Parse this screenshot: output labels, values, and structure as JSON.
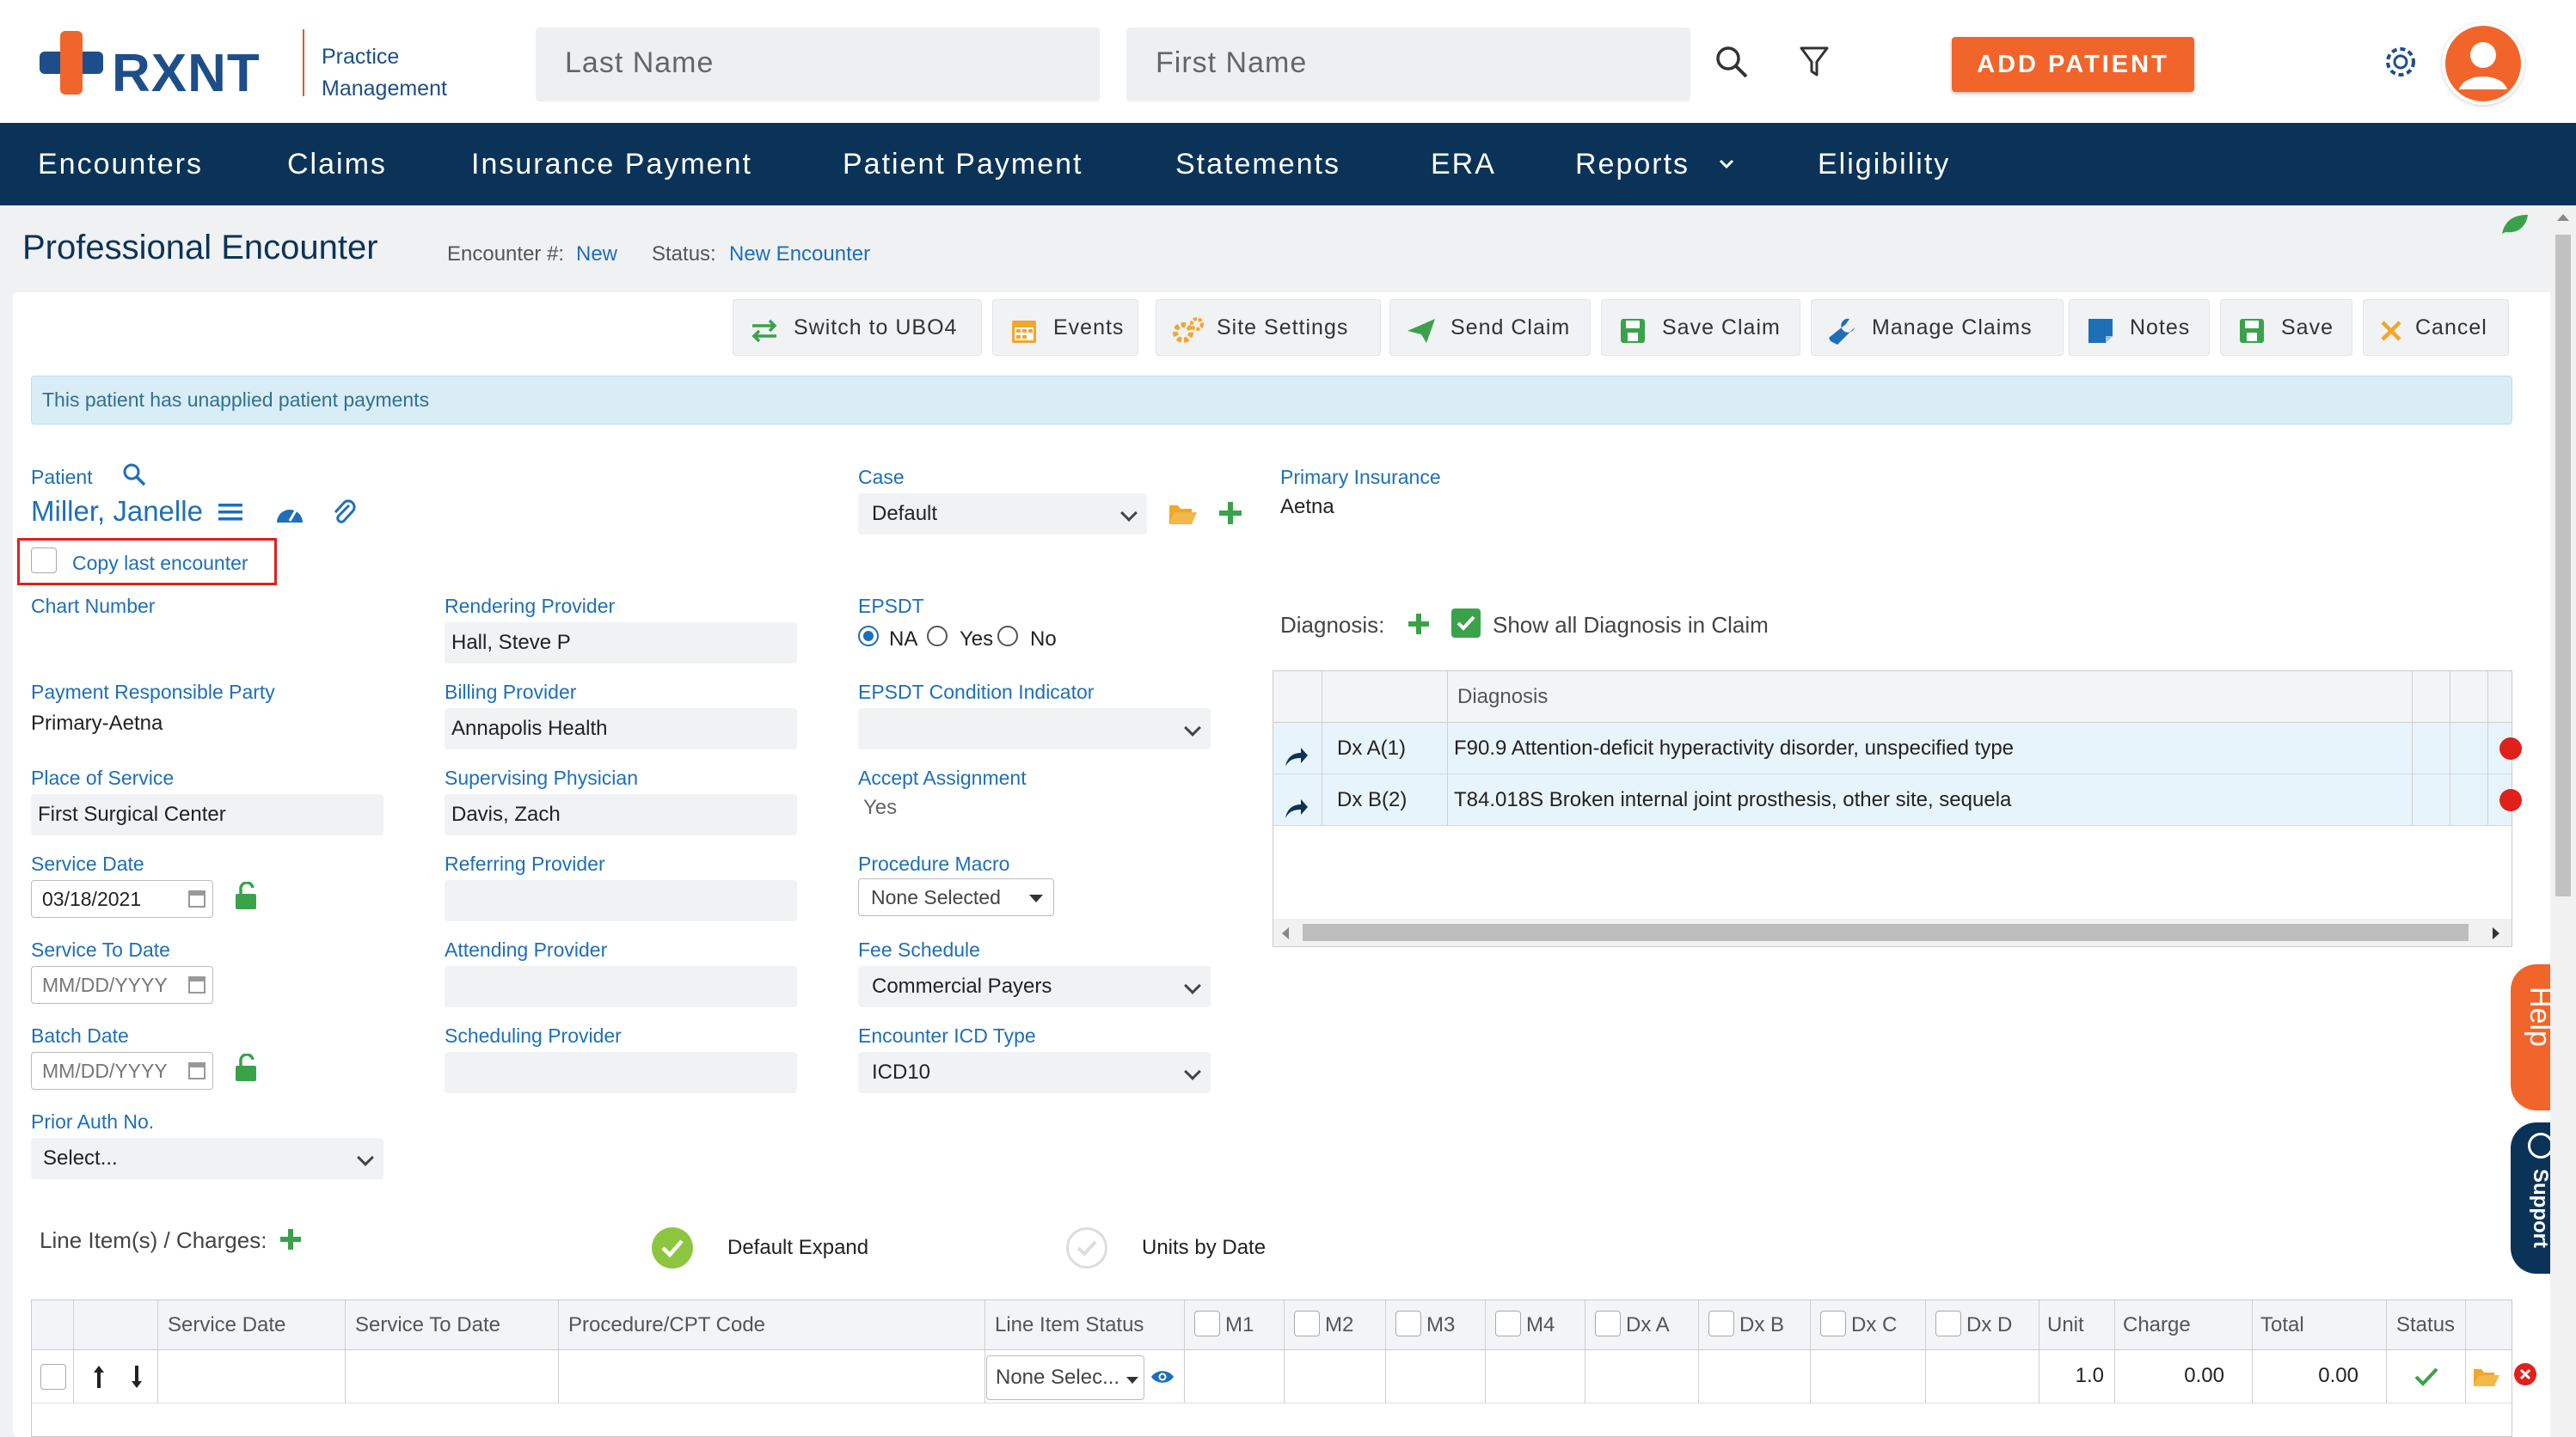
{
  "header": {
    "brand": "RXNT",
    "brand_sub_1": "Practice",
    "brand_sub_2": "Management",
    "last_name_placeholder": "Last Name",
    "first_name_placeholder": "First Name",
    "add_patient_label": "ADD PATIENT"
  },
  "nav": {
    "items": [
      "Encounters",
      "Claims",
      "Insurance Payment",
      "Patient Payment",
      "Statements",
      "ERA",
      "Reports",
      "Eligibility"
    ]
  },
  "page": {
    "title": "Professional Encounter",
    "encounter_label": "Encounter #:",
    "encounter_value": "New",
    "status_label": "Status:",
    "status_value": "New Encounter"
  },
  "toolbar": {
    "switch": "Switch to UBO4",
    "events": "Events",
    "site_settings": "Site Settings",
    "send_claim": "Send Claim",
    "save_claim": "Save Claim",
    "manage_claims": "Manage Claims",
    "notes": "Notes",
    "save": "Save",
    "cancel": "Cancel"
  },
  "alert": "This patient has unapplied patient payments",
  "form": {
    "patient_label": "Patient",
    "patient_name": "Miller, Janelle",
    "copy_last": "Copy last encounter",
    "chart_number_label": "Chart Number",
    "payment_party_label": "Payment Responsible Party",
    "payment_party_value": "Primary-Aetna",
    "place_of_service_label": "Place of Service",
    "place_of_service_value": "First Surgical Center",
    "service_date_label": "Service Date",
    "service_date_value": "03/18/2021",
    "service_to_date_label": "Service To Date",
    "service_to_date_placeholder": "MM/DD/YYYY",
    "batch_date_label": "Batch Date",
    "batch_date_placeholder": "MM/DD/YYYY",
    "prior_auth_label": "Prior Auth No.",
    "prior_auth_value": "Select...",
    "rendering_label": "Rendering Provider",
    "rendering_value": "Hall, Steve P",
    "billing_label": "Billing Provider",
    "billing_value": "Annapolis Health",
    "supervising_label": "Supervising Physician",
    "supervising_value": "Davis, Zach",
    "referring_label": "Referring Provider",
    "attending_label": "Attending Provider",
    "scheduling_label": "Scheduling Provider",
    "case_label": "Case",
    "case_value": "Default",
    "epsdt_label": "EPSDT",
    "epsdt_na": "NA",
    "epsdt_yes": "Yes",
    "epsdt_no": "No",
    "epsdt_cond_label": "EPSDT Condition Indicator",
    "accept_label": "Accept Assignment",
    "accept_value": "Yes",
    "macro_label": "Procedure Macro",
    "macro_value": "None Selected",
    "fee_label": "Fee Schedule",
    "fee_value": "Commercial Payers",
    "icd_label": "Encounter ICD Type",
    "icd_value": "ICD10",
    "primary_ins_label": "Primary Insurance",
    "primary_ins_value": "Aetna"
  },
  "diagnosis": {
    "label": "Diagnosis:",
    "show_all": "Show all Diagnosis in Claim",
    "column": "Diagnosis",
    "rows": [
      {
        "code": "Dx A(1)",
        "desc": "F90.9 Attention-deficit hyperactivity disorder, unspecified type"
      },
      {
        "code": "Dx B(2)",
        "desc": "T84.018S Broken internal joint prosthesis, other site, sequela"
      }
    ]
  },
  "lines": {
    "label": "Line Item(s) / Charges:",
    "default_expand": "Default Expand",
    "units_by_date": "Units by Date",
    "headers": {
      "service_date": "Service Date",
      "service_to_date": "Service To Date",
      "cpt": "Procedure/CPT Code",
      "status": "Line Item Status",
      "m1": "M1",
      "m2": "M2",
      "m3": "M3",
      "m4": "M4",
      "dxa": "Dx A",
      "dxb": "Dx B",
      "dxc": "Dx C",
      "dxd": "Dx D",
      "unit": "Unit",
      "charge": "Charge",
      "total": "Total",
      "row_status": "Status"
    },
    "row": {
      "line_status": "None Selec...",
      "unit": "1.0",
      "charge": "0.00",
      "total": "0.00"
    }
  },
  "side": {
    "help": "Help",
    "support": "Support"
  },
  "colors": {
    "nav_bg": "#0b3358",
    "accent_orange": "#f2652a",
    "link_blue": "#1e6fb8",
    "green": "#3aa24a"
  }
}
